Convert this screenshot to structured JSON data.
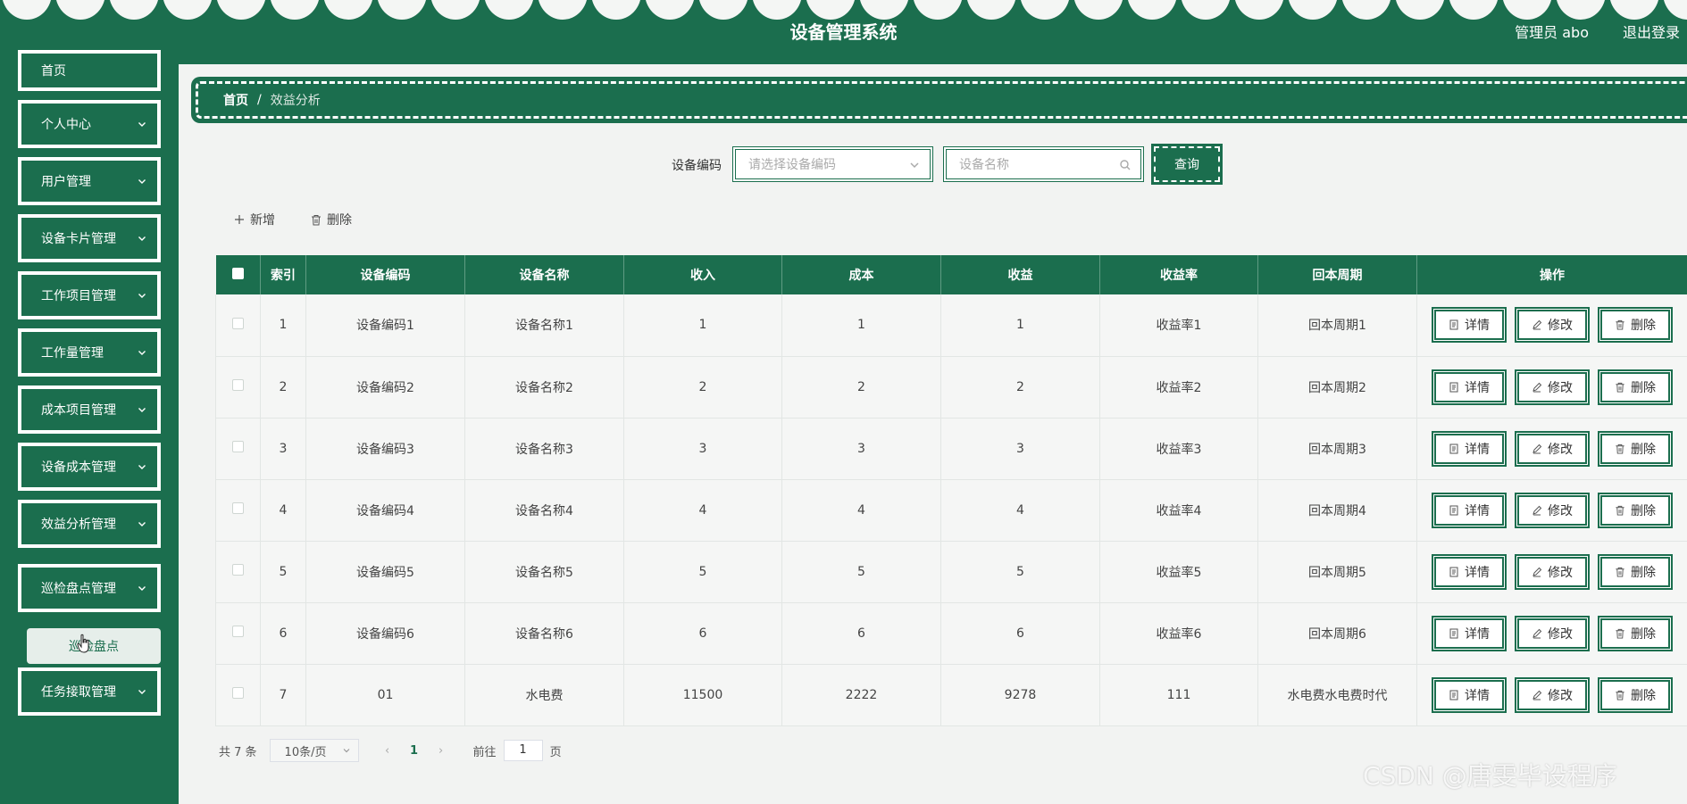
{
  "app": {
    "title": "设备管理系统",
    "user": "管理员 abo",
    "logout": "退出登录"
  },
  "sidebar": {
    "items": [
      {
        "label": "首页",
        "has_children": false
      },
      {
        "label": "个人中心",
        "has_children": true
      },
      {
        "label": "用户管理",
        "has_children": true
      },
      {
        "label": "设备卡片管理",
        "has_children": true
      },
      {
        "label": "工作项目管理",
        "has_children": true
      },
      {
        "label": "工作量管理",
        "has_children": true
      },
      {
        "label": "成本项目管理",
        "has_children": true
      },
      {
        "label": "设备成本管理",
        "has_children": true
      },
      {
        "label": "效益分析管理",
        "has_children": true
      },
      {
        "label": "巡检盘点管理",
        "has_children": true
      },
      {
        "label": "任务接取管理",
        "has_children": true
      }
    ],
    "submenu": {
      "label": "巡检盘点"
    }
  },
  "breadcrumb": {
    "home": "首页",
    "separator": "/",
    "current": "效益分析"
  },
  "search": {
    "label": "设备编码",
    "select_placeholder": "请选择设备编码",
    "name_placeholder": "设备名称",
    "query_button": "查询"
  },
  "toolbar": {
    "add_label": "新增",
    "delete_label": "删除"
  },
  "table": {
    "columns": [
      "索引",
      "设备编码",
      "设备名称",
      "收入",
      "成本",
      "收益",
      "收益率",
      "回本周期",
      "操作"
    ],
    "rows": [
      [
        "1",
        "设备编码1",
        "设备名称1",
        "1",
        "1",
        "1",
        "收益率1",
        "回本周期1"
      ],
      [
        "2",
        "设备编码2",
        "设备名称2",
        "2",
        "2",
        "2",
        "收益率2",
        "回本周期2"
      ],
      [
        "3",
        "设备编码3",
        "设备名称3",
        "3",
        "3",
        "3",
        "收益率3",
        "回本周期3"
      ],
      [
        "4",
        "设备编码4",
        "设备名称4",
        "4",
        "4",
        "4",
        "收益率4",
        "回本周期4"
      ],
      [
        "5",
        "设备编码5",
        "设备名称5",
        "5",
        "5",
        "5",
        "收益率5",
        "回本周期5"
      ],
      [
        "6",
        "设备编码6",
        "设备名称6",
        "6",
        "6",
        "6",
        "收益率6",
        "回本周期6"
      ],
      [
        "7",
        "01",
        "水电费",
        "11500",
        "2222",
        "9278",
        "111",
        "水电费水电费时代"
      ]
    ],
    "actions": {
      "detail": "详情",
      "edit": "修改",
      "delete": "删除"
    }
  },
  "pagination": {
    "total": "共 7 条",
    "page_size": "10条/页",
    "current_page": "1",
    "goto_prefix": "前往",
    "goto_value": "1",
    "goto_suffix": "页"
  },
  "watermark": "CSDN @唐雯毕设程序",
  "colors": {
    "primary": "#1b6e4e",
    "background": "#f2f3f2"
  }
}
